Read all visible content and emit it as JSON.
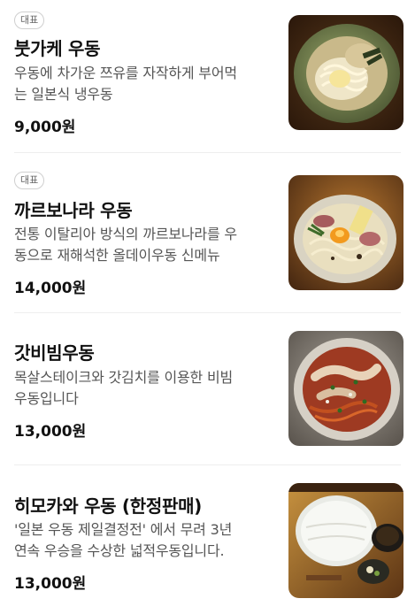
{
  "menu": [
    {
      "badge": "대표",
      "name": "붓가케 우동",
      "desc_lines": [
        "우동에 차가운 쯔유를 자작하게 부어먹",
        "는 일본식 냉우동"
      ],
      "price": "9,000원",
      "image": "bukkake-udon-photo"
    },
    {
      "badge": "대표",
      "name": "까르보나라 우동",
      "desc_lines": [
        "전통 이탈리아 방식의 까르보나라를 우",
        "동으로 재해석한 올데이우동 신메뉴"
      ],
      "price": "14,000원",
      "image": "carbonara-udon-photo"
    },
    {
      "badge": "",
      "name": "갓비빔우동",
      "desc_lines": [
        "목살스테이크와 갓김치를 이용한 비빔",
        "우동입니다"
      ],
      "price": "13,000원",
      "image": "gat-bibim-udon-photo"
    },
    {
      "badge": "",
      "name": "히모카와 우동 (한정판매)",
      "desc_lines": [
        "'일본 우동 제일결정전' 에서 무려 3년",
        "연속 우승을 수상한 넓적우동입니다."
      ],
      "price": "13,000원",
      "image": "himokawa-udon-photo"
    }
  ]
}
